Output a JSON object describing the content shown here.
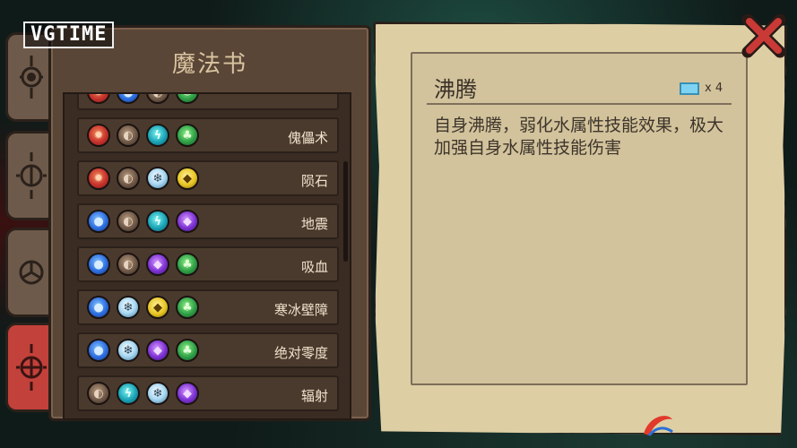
{
  "watermark_top_left": "VGTIME",
  "book": {
    "title": "魔法书",
    "spells": [
      {
        "label": "",
        "elements": [
          "fire",
          "water",
          "earth",
          "nature"
        ]
      },
      {
        "label": "傀儡术",
        "elements": [
          "fire",
          "earth",
          "light",
          "nature"
        ]
      },
      {
        "label": "陨石",
        "elements": [
          "fire",
          "earth",
          "ice",
          "gold"
        ]
      },
      {
        "label": "地震",
        "elements": [
          "water",
          "earth",
          "light",
          "arcane"
        ]
      },
      {
        "label": "吸血",
        "elements": [
          "water",
          "earth",
          "arcane",
          "nature"
        ]
      },
      {
        "label": "寒冰壁障",
        "elements": [
          "water",
          "ice",
          "gold",
          "nature"
        ]
      },
      {
        "label": "绝对零度",
        "elements": [
          "water",
          "ice",
          "arcane",
          "nature"
        ]
      },
      {
        "label": "辐射",
        "elements": [
          "earth",
          "light",
          "ice",
          "arcane"
        ]
      }
    ]
  },
  "detail": {
    "title": "沸腾",
    "cost": "x 4",
    "description": "自身沸腾，弱化水属性技能效果，极大加强自身水属性技能伤害"
  },
  "tabs": [
    "tab-1",
    "tab-2",
    "tab-3",
    "tab-4"
  ],
  "active_tab_index": 3,
  "colors": {
    "book_bg": "#5a4637",
    "parchment": "#ddcea4",
    "active_tab": "#c2413b",
    "close_x": "#c93a36"
  }
}
